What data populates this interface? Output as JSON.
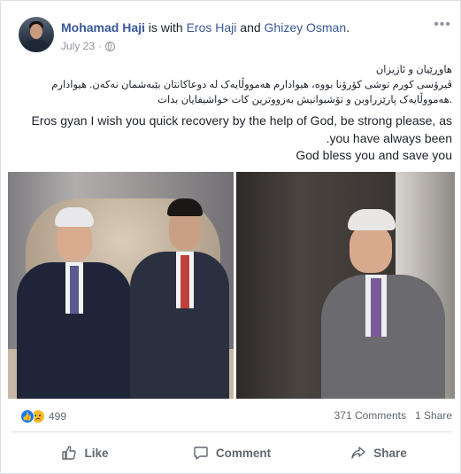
{
  "post": {
    "author": "Mohamad Haji",
    "with_text": " is with ",
    "tagged_1": "Eros Haji",
    "and_text": " and ",
    "tagged_2": "Ghizey Osman",
    "end_text": ".",
    "date": "July 23",
    "privacy_icon": "globe-icon",
    "menu_icon": "more-options-icon",
    "text_lines": [
      "هاوڕێیان و ئازیزان",
      "ڤیرۆسی کورم توشی کۆرۆنا بووە، هیوادارم هەمووڵایەک لە دوعاکانتان بێبەشمان نەکەن. هیوادارم",
      "هەمووڵایەک پارێزراوبن و تۆشبوانیش بەزووترین کات خواشیفایان بدات."
    ],
    "english_lines": [
      "Eros gyan I wish you quick recovery by the help of God, be strong please, as",
      ".you have always been",
      "God bless you and save you"
    ]
  },
  "stats": {
    "reaction_count": "499",
    "comments": "371 Comments",
    "shares": "1 Share"
  },
  "actions": {
    "like": "Like",
    "comment": "Comment",
    "share": "Share"
  },
  "colors": {
    "link": "#385898",
    "like_blue": "#1877f2",
    "sad_yellow": "#f7b928",
    "muted": "#606770"
  }
}
